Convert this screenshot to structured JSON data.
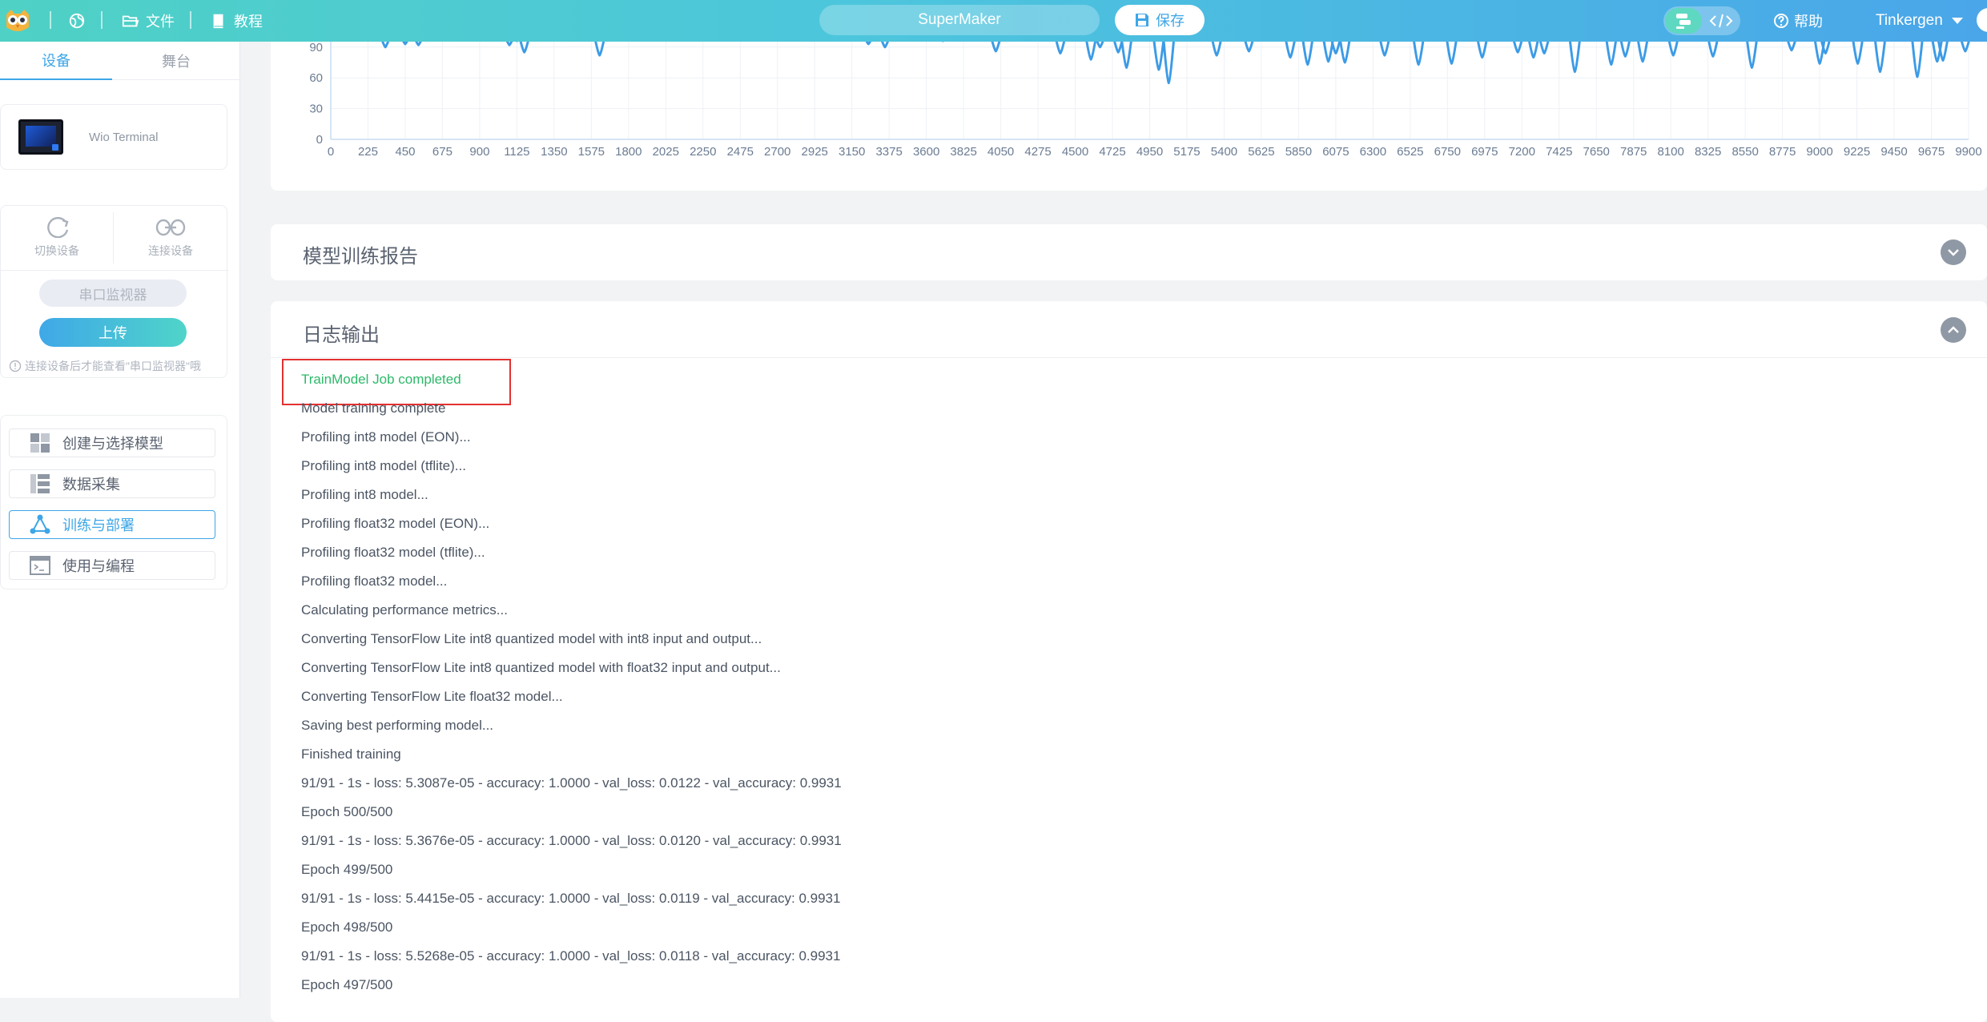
{
  "header": {
    "file_label": "文件",
    "tutorial_label": "教程",
    "project_name": "SuperMaker",
    "save_label": "保存",
    "help_label": "帮助",
    "user_name": "Tinkergen",
    "icons": [
      "owl-logo-icon",
      "globe-icon",
      "folder-icon",
      "book-icon",
      "save-icon",
      "block-mode-icon",
      "code-icon",
      "help-icon",
      "caret-down-icon"
    ]
  },
  "sidebar": {
    "tabs": [
      {
        "label": "设备"
      },
      {
        "label": "舞台"
      }
    ],
    "device": {
      "name": "Wio Terminal"
    },
    "connection": {
      "switch_label": "切换设备",
      "connect_label": "连接设备",
      "serial_label": "串口监视器",
      "upload_label": "上传",
      "hint": "连接设备后才能查看\"串口监视器\"哦"
    },
    "nav": [
      {
        "label": "创建与选择模型",
        "icon": "model-grid-icon"
      },
      {
        "label": "数据采集",
        "icon": "data-collect-icon"
      },
      {
        "label": "训练与部署",
        "icon": "train-deploy-icon",
        "active": true
      },
      {
        "label": "使用与编程",
        "icon": "terminal-icon"
      }
    ]
  },
  "main": {
    "report_title": "模型训练报告",
    "log_title": "日志输出",
    "log_lines": [
      "TrainModel Job completed",
      "Model training complete",
      "Profiling int8 model (EON)...",
      "Profiling int8 model (tflite)...",
      "Profiling int8 model...",
      "Profiling float32 model (EON)...",
      "Profiling float32 model (tflite)...",
      "Profiling float32 model...",
      "Calculating performance metrics...",
      "Converting TensorFlow Lite int8 quantized model with int8 input and output...",
      "Converting TensorFlow Lite int8 quantized model with float32 input and output...",
      "Converting TensorFlow Lite float32 model...",
      "Saving best performing model...",
      "Finished training",
      "91/91 - 1s - loss: 5.3087e-05 - accuracy: 1.0000 - val_loss: 0.0122 - val_accuracy: 0.9931",
      "Epoch 500/500",
      "91/91 - 1s - loss: 5.3676e-05 - accuracy: 1.0000 - val_loss: 0.0120 - val_accuracy: 0.9931",
      "Epoch 499/500",
      "91/91 - 1s - loss: 5.4415e-05 - accuracy: 1.0000 - val_loss: 0.0119 - val_accuracy: 0.9931",
      "Epoch 498/500",
      "91/91 - 1s - loss: 5.5268e-05 - accuracy: 1.0000 - val_loss: 0.0118 - val_accuracy: 0.9931",
      "Epoch 497/500"
    ]
  },
  "chart_data": {
    "type": "line",
    "y_ticks": [
      0,
      30,
      60,
      90
    ],
    "x_ticks": [
      0,
      225,
      450,
      675,
      900,
      1125,
      1350,
      1575,
      1800,
      2025,
      2250,
      2475,
      2700,
      2925,
      3150,
      3375,
      3600,
      3825,
      4050,
      4275,
      4500,
      4725,
      4950,
      5175,
      5400,
      5625,
      5850,
      6075,
      6300,
      6525,
      6750,
      6975,
      7200,
      7425,
      7650,
      7875,
      8100,
      8325,
      8550,
      8775,
      9000,
      9225,
      9450,
      9675,
      9900
    ],
    "ylim": [
      0,
      100
    ],
    "xlim": [
      0,
      9900
    ],
    "line_color": "#3c9be6",
    "series": [
      {
        "x": [
          330,
          450,
          530,
          1080,
          1125,
          1170,
          1300,
          1625,
          2735,
          3250,
          3350,
          3700,
          4020,
          4410,
          4595,
          4650,
          4760,
          4810,
          5005,
          5065,
          5355,
          5550,
          5800,
          5905,
          6030,
          6075,
          6130,
          6370,
          6575,
          6775,
          6960,
          7175,
          7270,
          7335,
          7520,
          7740,
          7825,
          7930,
          8115,
          8355,
          8590,
          8830,
          9000,
          9035,
          9230,
          9365,
          9590,
          9710,
          9745,
          9880
        ],
        "y": [
          90,
          93,
          92,
          92,
          96,
          85,
          97,
          82,
          97,
          93,
          90,
          96,
          86,
          84,
          78,
          90,
          85,
          70,
          68,
          55,
          82,
          86,
          80,
          73,
          76,
          84,
          75,
          82,
          73,
          74,
          80,
          85,
          80,
          84,
          66,
          73,
          81,
          76,
          82,
          81,
          70,
          87,
          74,
          84,
          74,
          66,
          61,
          76,
          77,
          86
        ]
      }
    ]
  }
}
